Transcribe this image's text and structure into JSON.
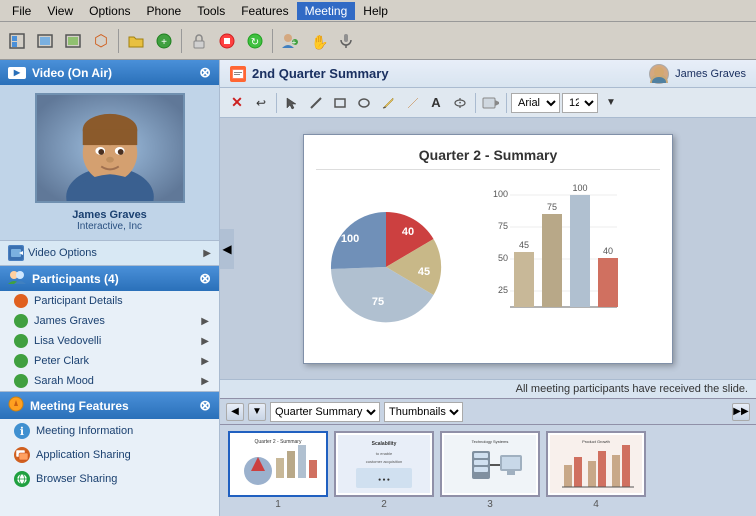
{
  "menubar": {
    "items": [
      "File",
      "View",
      "Options",
      "Phone",
      "Tools",
      "Features",
      "Meeting",
      "Help"
    ]
  },
  "sidebar": {
    "video_panel": {
      "title": "Video (On Air)",
      "person_name": "James Graves",
      "person_company": "Interactive, Inc",
      "options_label": "Video Options"
    },
    "participants": {
      "title": "Participants (4)",
      "items": [
        {
          "name": "Participant Details",
          "color": "#e06020"
        },
        {
          "name": "James Graves",
          "color": "#40a040"
        },
        {
          "name": "Lisa Vedovelli",
          "color": "#40a040"
        },
        {
          "name": "Peter Clark",
          "color": "#40a040"
        },
        {
          "name": "Sarah Mood",
          "color": "#40a040"
        }
      ]
    },
    "features": {
      "title": "Meeting Features",
      "items": [
        {
          "name": "Meeting Information",
          "icon": "ℹ",
          "color": "#4090d0"
        },
        {
          "name": "Application Sharing",
          "icon": "⬜",
          "color": "#d06020"
        },
        {
          "name": "Browser Sharing",
          "icon": "⬜",
          "color": "#20a040"
        }
      ]
    }
  },
  "presentation": {
    "title": "2nd Quarter Summary",
    "presenter": "James Graves",
    "slide_title": "Quarter 2 - Summary",
    "status": "All meeting participants have received the slide."
  },
  "toolbar": {
    "font": "Arial",
    "font_size": "12"
  },
  "thumbnails": {
    "label": "Quarter Summary",
    "view": "Thumbnails",
    "slides": [
      {
        "number": "1",
        "label": "Quarter Summary"
      },
      {
        "number": "2",
        "label": "Scalability"
      },
      {
        "number": "3",
        "label": "Technology Systems"
      },
      {
        "number": "4",
        "label": "Product Growth"
      }
    ]
  },
  "chart": {
    "pie_segments": [
      {
        "label": "40",
        "color": "#d05050"
      },
      {
        "label": "45",
        "color": "#d4c890"
      },
      {
        "label": "75",
        "color": "#b8c8d8"
      },
      {
        "label": "100",
        "color": "#7090b8"
      }
    ],
    "bars": [
      {
        "value": 45,
        "color": "#c8b898",
        "label": "45"
      },
      {
        "value": 75,
        "color": "#b8a888",
        "label": "75"
      },
      {
        "value": 100,
        "color": "#b0c0d0",
        "label": "100"
      },
      {
        "value": 40,
        "color": "#d07060",
        "label": "40"
      }
    ],
    "max": 100
  }
}
